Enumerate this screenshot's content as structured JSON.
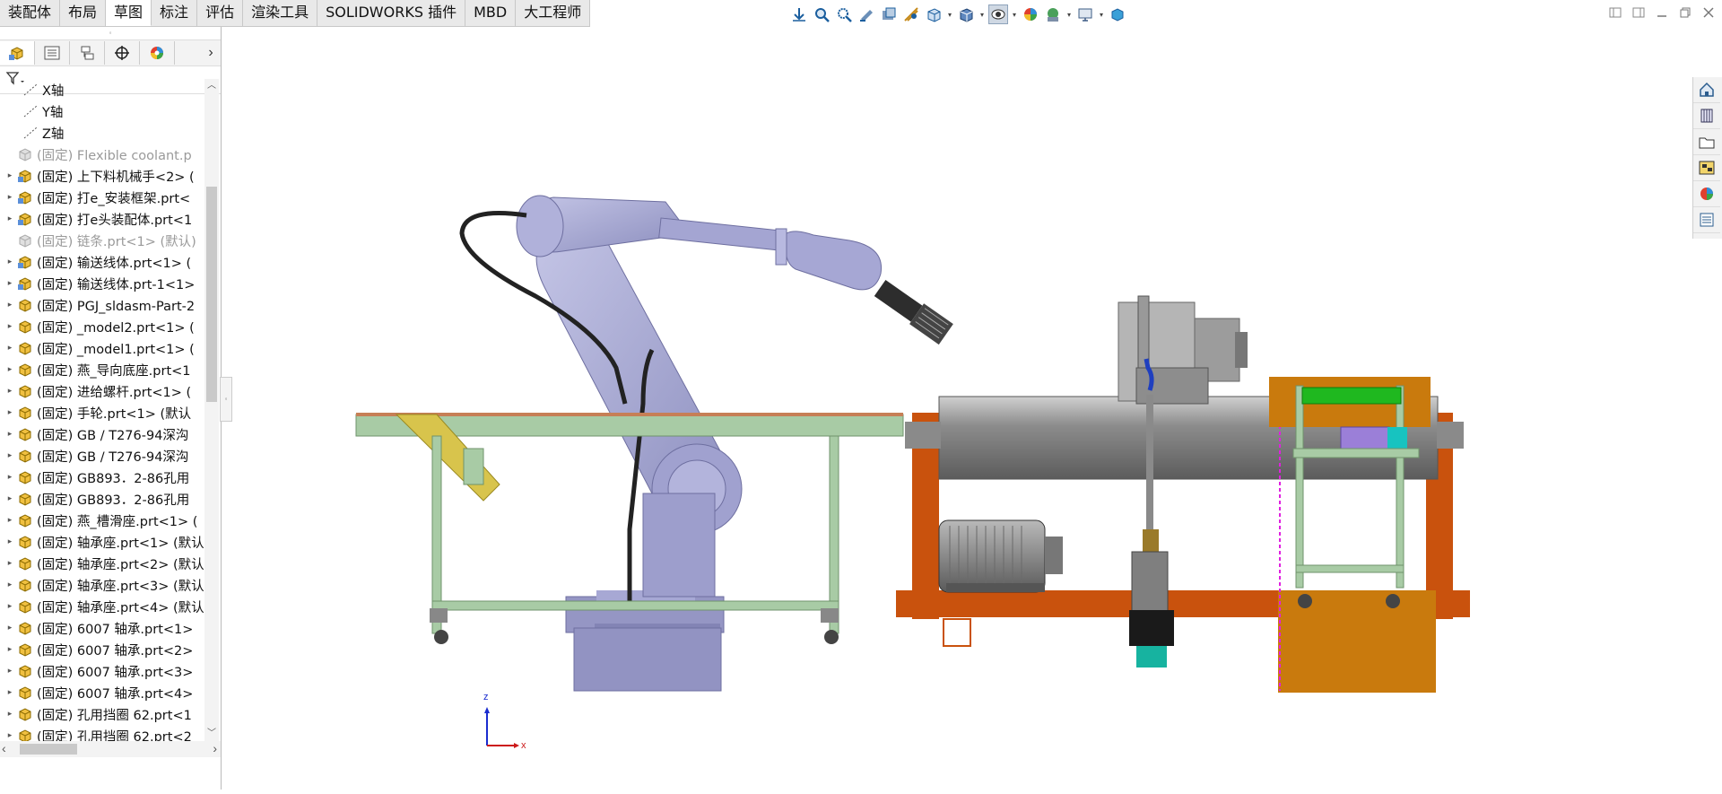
{
  "tabs": [
    "装配体",
    "布局",
    "草图",
    "标注",
    "评估",
    "渲染工具",
    "SOLIDWORKS 插件",
    "MBD",
    "大工程师"
  ],
  "active_tab": "草图",
  "hud_icons": [
    "view-orientation-icon",
    "zoom-to-fit-icon",
    "zoom-to-area-icon",
    "previous-view-icon",
    "section-view-icon",
    "dynamic-annotation-icon",
    "view-cube-icon",
    "display-style-icon",
    "hide-show-icon",
    "edit-appearance-icon",
    "apply-scene-icon",
    "view-settings-icon",
    "3d-view-icon"
  ],
  "panel": {
    "tabs": [
      "featuremanager-icon",
      "propertymanager-icon",
      "configurationmanager-icon",
      "dimxpert-icon",
      "displaymanager-icon"
    ],
    "more": "›",
    "filter_icon": "filter-icon"
  },
  "tree": [
    {
      "label": "X轴",
      "type": "axis",
      "expand": false,
      "gray": false
    },
    {
      "label": "Y轴",
      "type": "axis",
      "expand": false,
      "gray": false
    },
    {
      "label": "Z轴",
      "type": "axis",
      "expand": false,
      "gray": false
    },
    {
      "label": "(固定) Flexible coolant.p",
      "type": "asm",
      "expand": false,
      "gray": true
    },
    {
      "label": "(固定) 上下料机械手<2> (",
      "type": "asm",
      "expand": true,
      "gray": false
    },
    {
      "label": "(固定) 打e_安装框架.prt<",
      "type": "asm",
      "expand": true,
      "gray": false
    },
    {
      "label": "(固定) 打e头装配体.prt<1",
      "type": "asm",
      "expand": true,
      "gray": false
    },
    {
      "label": "(固定) 链条.prt<1> (默认)",
      "type": "asm",
      "expand": false,
      "gray": true
    },
    {
      "label": "(固定) 输送线体.prt<1> (",
      "type": "asm",
      "expand": true,
      "gray": false
    },
    {
      "label": "(固定) 输送线体.prt-1<1>",
      "type": "asm",
      "expand": true,
      "gray": false
    },
    {
      "label": "(固定) PGJ_sldasm-Part-2",
      "type": "part",
      "expand": true,
      "gray": false
    },
    {
      "label": "(固定) _model2.prt<1> (",
      "type": "part",
      "expand": true,
      "gray": false
    },
    {
      "label": "(固定) _model1.prt<1> (",
      "type": "part",
      "expand": true,
      "gray": false
    },
    {
      "label": "(固定) 燕_导向底座.prt<1",
      "type": "part",
      "expand": true,
      "gray": false
    },
    {
      "label": "(固定) 进给螺杆.prt<1> (",
      "type": "part",
      "expand": true,
      "gray": false
    },
    {
      "label": "(固定) 手轮.prt<1> (默认",
      "type": "part",
      "expand": true,
      "gray": false
    },
    {
      "label": "(固定) GB / T276-94深沟",
      "type": "part",
      "expand": true,
      "gray": false
    },
    {
      "label": "(固定) GB / T276-94深沟",
      "type": "part",
      "expand": true,
      "gray": false
    },
    {
      "label": "(固定) GB893．2-86孔用",
      "type": "part",
      "expand": true,
      "gray": false
    },
    {
      "label": "(固定) GB893．2-86孔用",
      "type": "part",
      "expand": true,
      "gray": false
    },
    {
      "label": "(固定) 燕_槽滑座.prt<1> (",
      "type": "part",
      "expand": true,
      "gray": false
    },
    {
      "label": "(固定) 轴承座.prt<1> (默认",
      "type": "part",
      "expand": true,
      "gray": false
    },
    {
      "label": "(固定) 轴承座.prt<2> (默认",
      "type": "part",
      "expand": true,
      "gray": false
    },
    {
      "label": "(固定) 轴承座.prt<3> (默认",
      "type": "part",
      "expand": true,
      "gray": false
    },
    {
      "label": "(固定) 轴承座.prt<4> (默认",
      "type": "part",
      "expand": true,
      "gray": false
    },
    {
      "label": "(固定) 6007 轴承.prt<1>",
      "type": "part",
      "expand": true,
      "gray": false
    },
    {
      "label": "(固定) 6007 轴承.prt<2>",
      "type": "part",
      "expand": true,
      "gray": false
    },
    {
      "label": "(固定) 6007 轴承.prt<3>",
      "type": "part",
      "expand": true,
      "gray": false
    },
    {
      "label": "(固定) 6007 轴承.prt<4>",
      "type": "part",
      "expand": true,
      "gray": false
    },
    {
      "label": "(固定) 孔用挡圈 62.prt<1",
      "type": "part",
      "expand": true,
      "gray": false
    },
    {
      "label": "(固定) 孔用挡圈 62.prt<2",
      "type": "part",
      "expand": true,
      "gray": false
    }
  ],
  "taskpane": [
    "home-icon",
    "design-library-icon",
    "file-explorer-icon",
    "view-palette-icon",
    "appearances-icon",
    "custom-properties-icon"
  ],
  "triad": {
    "z": "z",
    "x": "x"
  },
  "colors": {
    "robot": "#9e9fcd",
    "frame_green": "#a8cba5",
    "frame_orange": "#c9520d",
    "pipe_gray": "#8a8a8a"
  }
}
